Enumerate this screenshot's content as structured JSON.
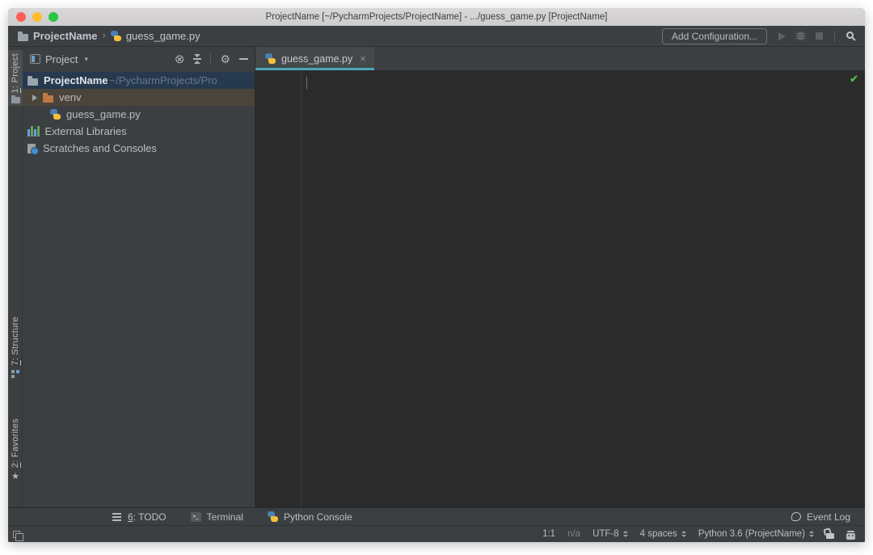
{
  "window_title": "ProjectName [~/PycharmProjects/ProjectName] - .../guess_game.py [ProjectName]",
  "navbar": {
    "breadcrumb_project": "ProjectName",
    "breadcrumb_separator": "›",
    "breadcrumb_file": "guess_game.py",
    "add_configuration_label": "Add Configuration..."
  },
  "project_panel": {
    "title": "Project",
    "dropdown_caret": "▾",
    "locate_glyph": "⊗",
    "gear_glyph": "⚙",
    "tree": {
      "root": {
        "label": "ProjectName",
        "path": "~/PycharmProjects/Pro"
      },
      "venv": {
        "label": "venv"
      },
      "file": {
        "label": "guess_game.py"
      },
      "external_libraries": {
        "label": "External Libraries"
      },
      "scratches": {
        "label": "Scratches and Consoles"
      }
    }
  },
  "stripe": {
    "project": {
      "num": "1",
      "rest": ": Project"
    },
    "structure": {
      "num": "7",
      "rest": ": Structure"
    },
    "favorites": {
      "num": "2",
      "rest": ": Favorites"
    },
    "star_glyph": "★"
  },
  "editor": {
    "tab_label": "guess_game.py",
    "close_glyph": "×",
    "inspection_check_glyph": "✔"
  },
  "bottom_bar": {
    "todo": {
      "num": "6",
      "rest": ": TODO"
    },
    "terminal_label": "Terminal",
    "python_console_label": "Python Console",
    "event_log_label": "Event Log"
  },
  "status_bar": {
    "caret_position": "1:1",
    "line_separator": "n/a",
    "encoding": "UTF-8",
    "indent": "4 spaces",
    "interpreter": "Python 3.6 (ProjectName)"
  },
  "colors": {
    "chrome_bg": "#3c3f41",
    "editor_bg": "#2b2b2b",
    "selection_bg": "#26394e",
    "venv_row_bg": "#4a443a",
    "tab_underline": "#4ba6b8",
    "check_green": "#4cb84c",
    "titlebar_bg": "#d4d2d2",
    "traffic_red": "#ff5f57",
    "traffic_yellow": "#febc2e",
    "traffic_green": "#28c840"
  }
}
